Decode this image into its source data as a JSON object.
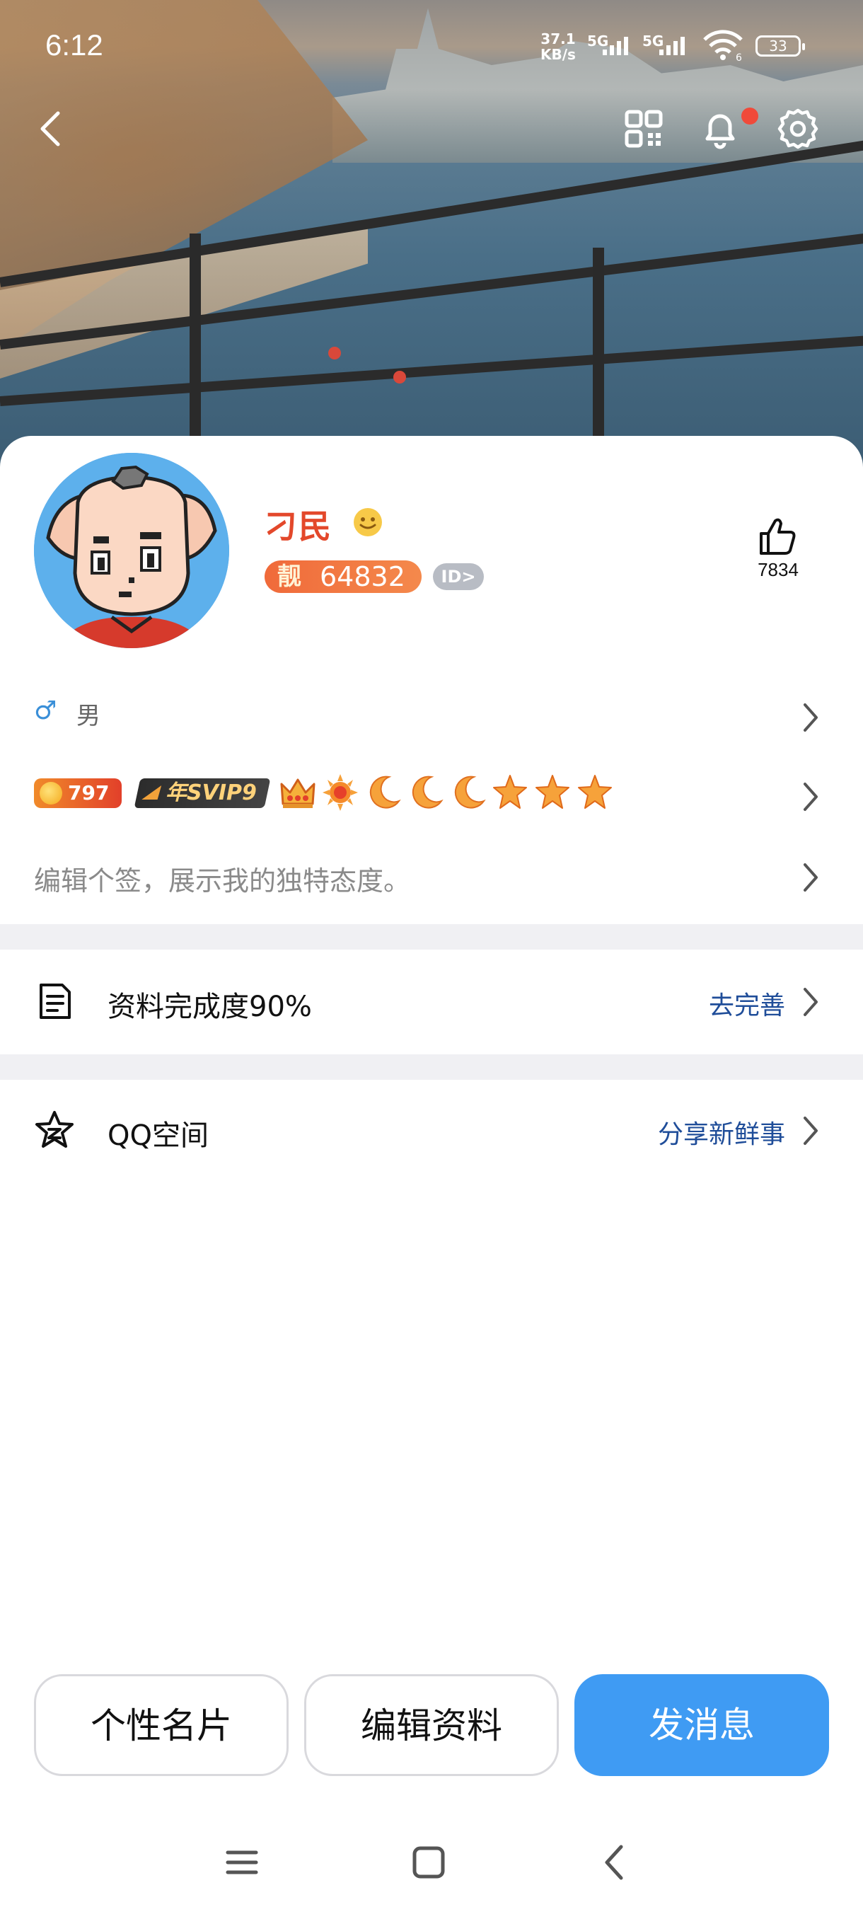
{
  "status_bar": {
    "time": "6:12",
    "net_speed_value": "37.1",
    "net_speed_unit": "KB/s",
    "sim1": "5G",
    "sim2": "5G",
    "wifi_badge": "6",
    "battery": "33"
  },
  "top_actions": {
    "back_icon": "chevron-left-icon",
    "qr_icon": "qr-code-icon",
    "bell_icon": "bell-icon",
    "settings_icon": "gear-icon",
    "notification_dot_color": "#f04a3a"
  },
  "profile": {
    "nickname": "刁民",
    "status_icon": "smile-emoji-icon",
    "qq_badge_prefix": "靓",
    "qq_number": "64832",
    "id_chip": "ID>",
    "likes": "7834",
    "gender_symbol": "♂",
    "gender": "男",
    "level_number": "797",
    "svip_label": "年SVIP9",
    "level_icons": [
      "crown-icon",
      "sun-icon",
      "moon-icon",
      "moon-icon",
      "moon-icon",
      "star-icon",
      "star-icon",
      "star-icon"
    ],
    "signature_placeholder": "编辑个签，展示我的独特态度。"
  },
  "rows": {
    "completeness": {
      "label": "资料完成度90%",
      "action": "去完善"
    },
    "qzone": {
      "label": "QQ空间",
      "action": "分享新鲜事"
    }
  },
  "buttons": {
    "card": "个性名片",
    "edit": "编辑资料",
    "message": "发消息"
  },
  "colors": {
    "accent": "#3f9bf3",
    "nickname": "#e3482b",
    "link": "#1f4d99"
  }
}
